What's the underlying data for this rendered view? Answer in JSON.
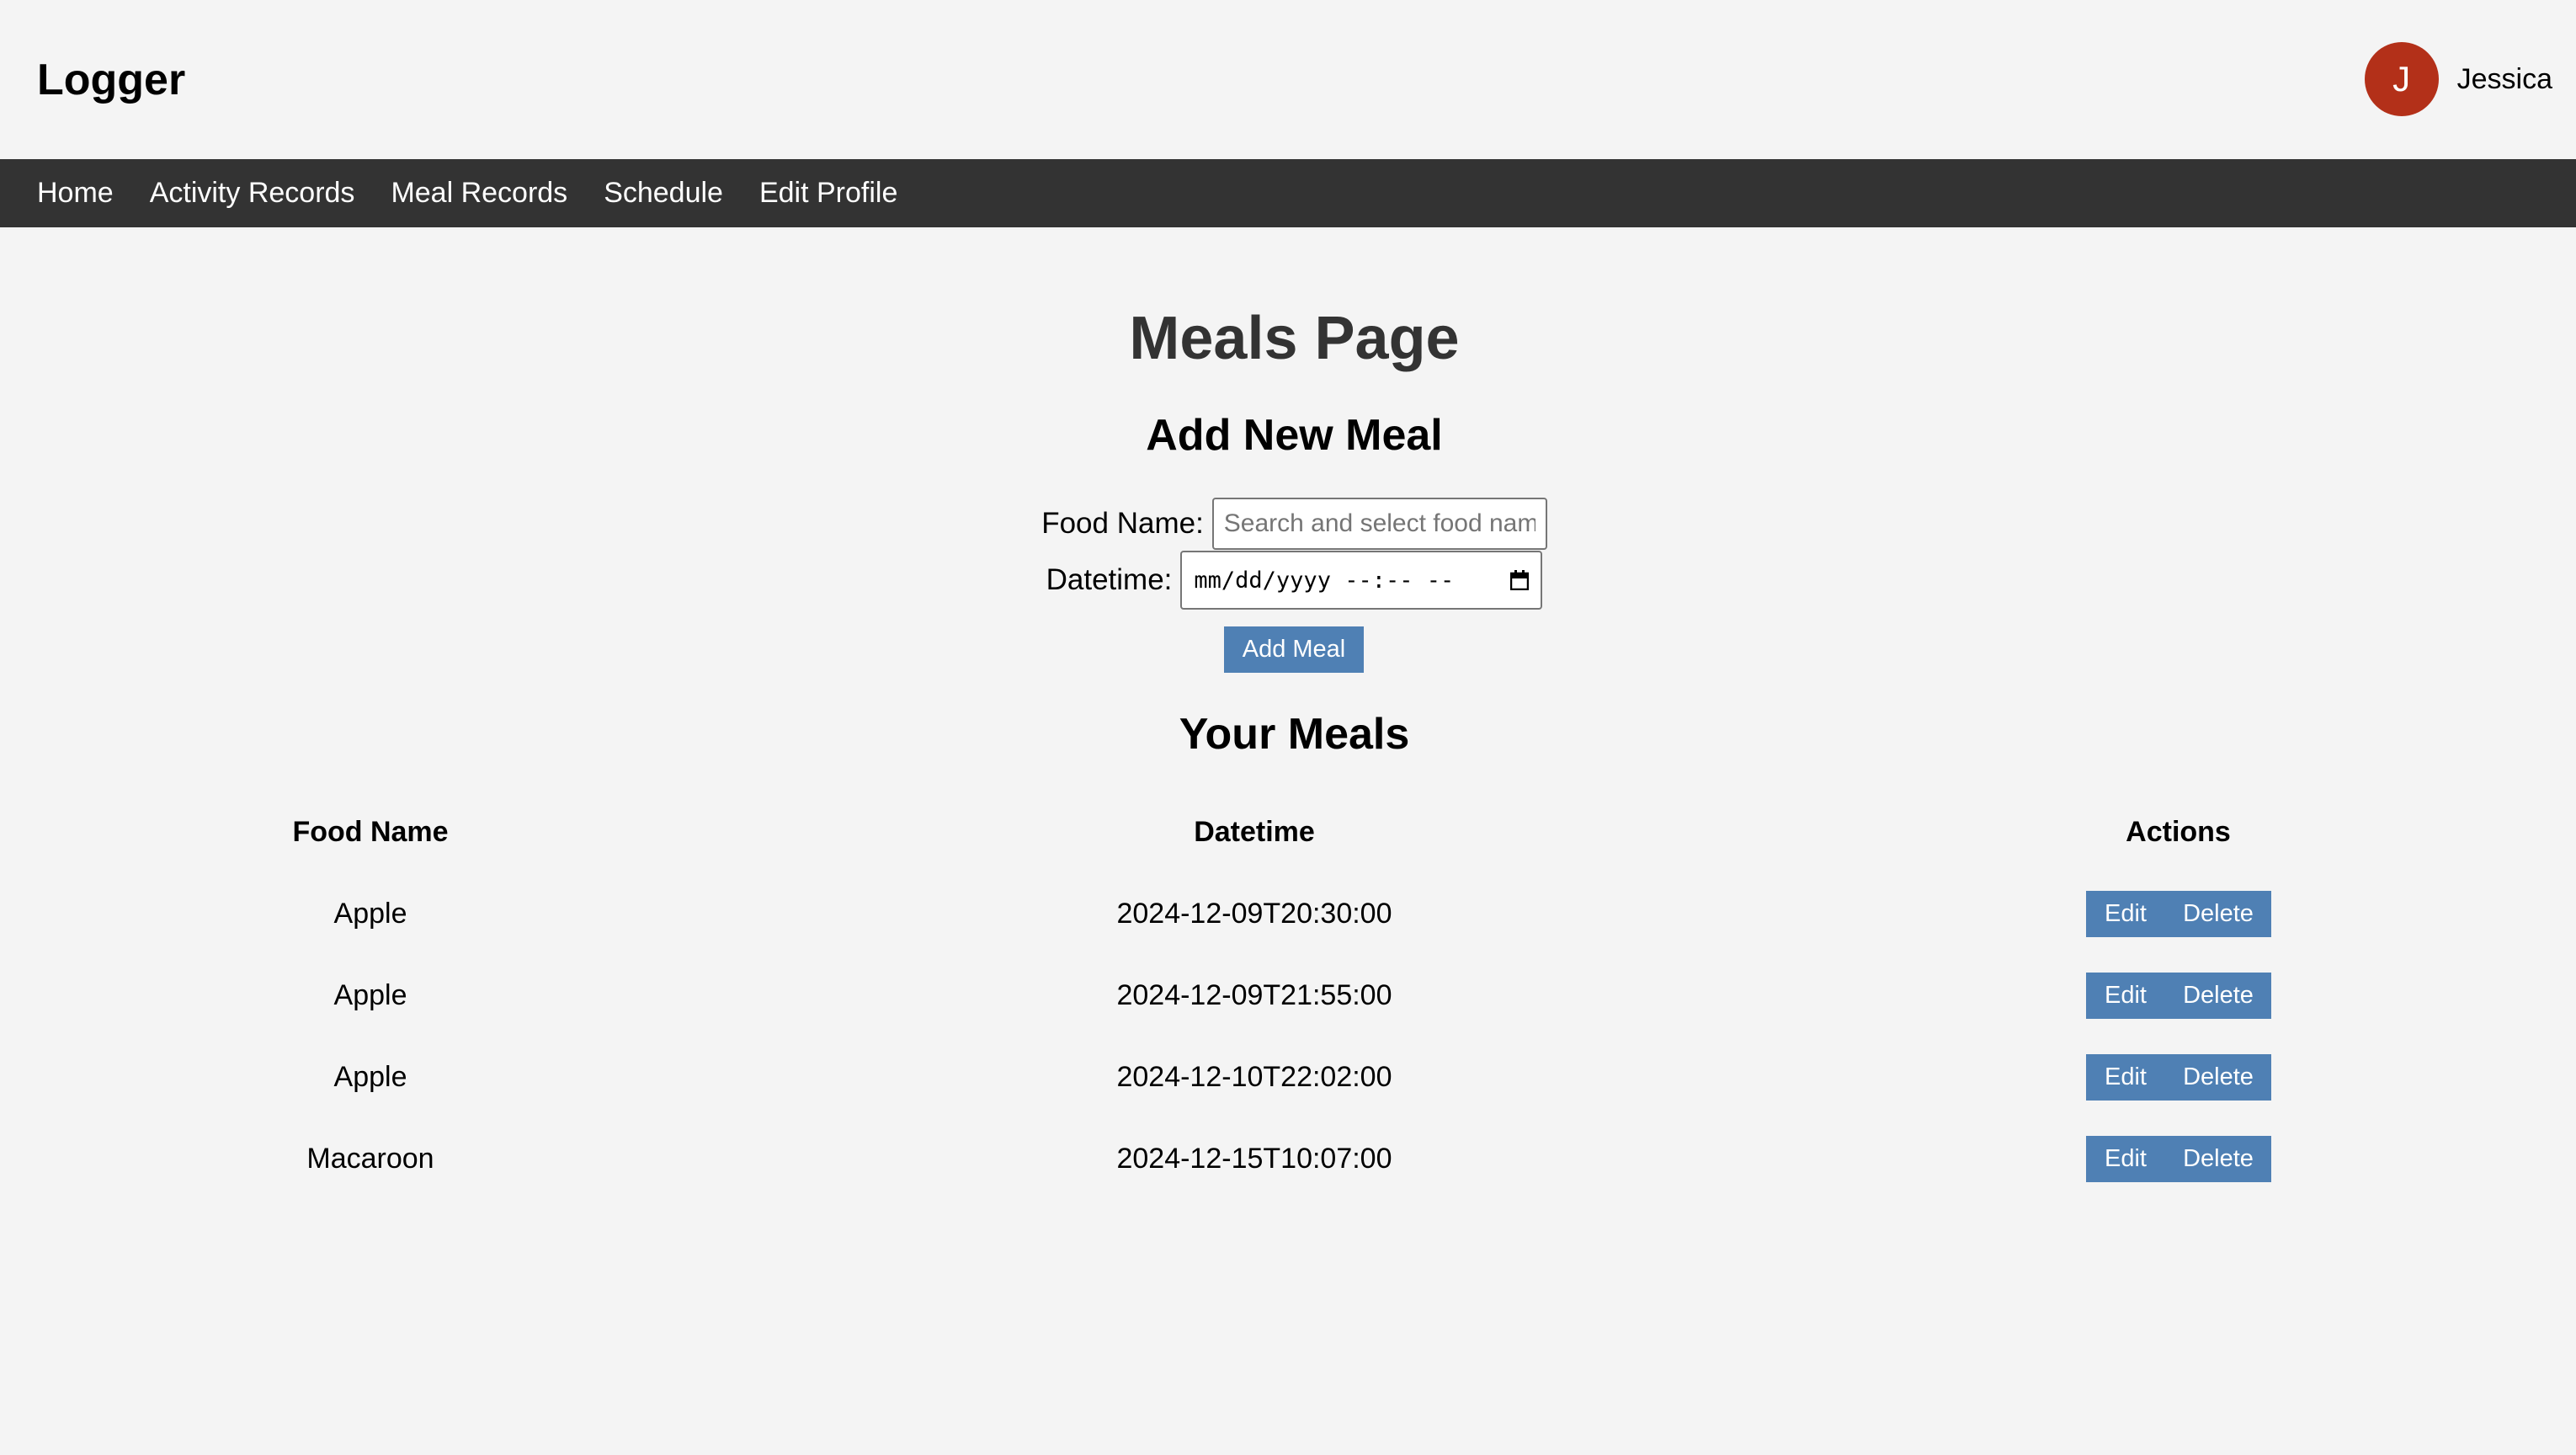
{
  "app": {
    "title": "Logger"
  },
  "user": {
    "initial": "J",
    "name": "Jessica",
    "avatar_color": "#b33019"
  },
  "nav": {
    "items": [
      {
        "label": "Home"
      },
      {
        "label": "Activity Records"
      },
      {
        "label": "Meal Records"
      },
      {
        "label": "Schedule"
      },
      {
        "label": "Edit Profile"
      }
    ]
  },
  "page": {
    "title": "Meals Page"
  },
  "add_form": {
    "heading": "Add New Meal",
    "food_label": "Food Name:",
    "food_placeholder": "Search and select food name",
    "food_value": "",
    "datetime_label": "Datetime:",
    "datetime_placeholder": "mm/dd/yyyy --:-- --",
    "datetime_icon": "calendar-icon",
    "submit_label": "Add Meal"
  },
  "meals": {
    "heading": "Your Meals",
    "columns": [
      "Food Name",
      "Datetime",
      "Actions"
    ],
    "rows": [
      {
        "food": "Apple",
        "datetime": "2024-12-09T20:30:00",
        "edit": "Edit",
        "delete": "Delete"
      },
      {
        "food": "Apple",
        "datetime": "2024-12-09T21:55:00",
        "edit": "Edit",
        "delete": "Delete"
      },
      {
        "food": "Apple",
        "datetime": "2024-12-10T22:02:00",
        "edit": "Edit",
        "delete": "Delete"
      },
      {
        "food": "Macaroon",
        "datetime": "2024-12-15T10:07:00",
        "edit": "Edit",
        "delete": "Delete"
      }
    ]
  },
  "colors": {
    "navbar_bg": "#333333",
    "button_bg": "#4f80b4",
    "page_bg": "#f4f4f4"
  }
}
